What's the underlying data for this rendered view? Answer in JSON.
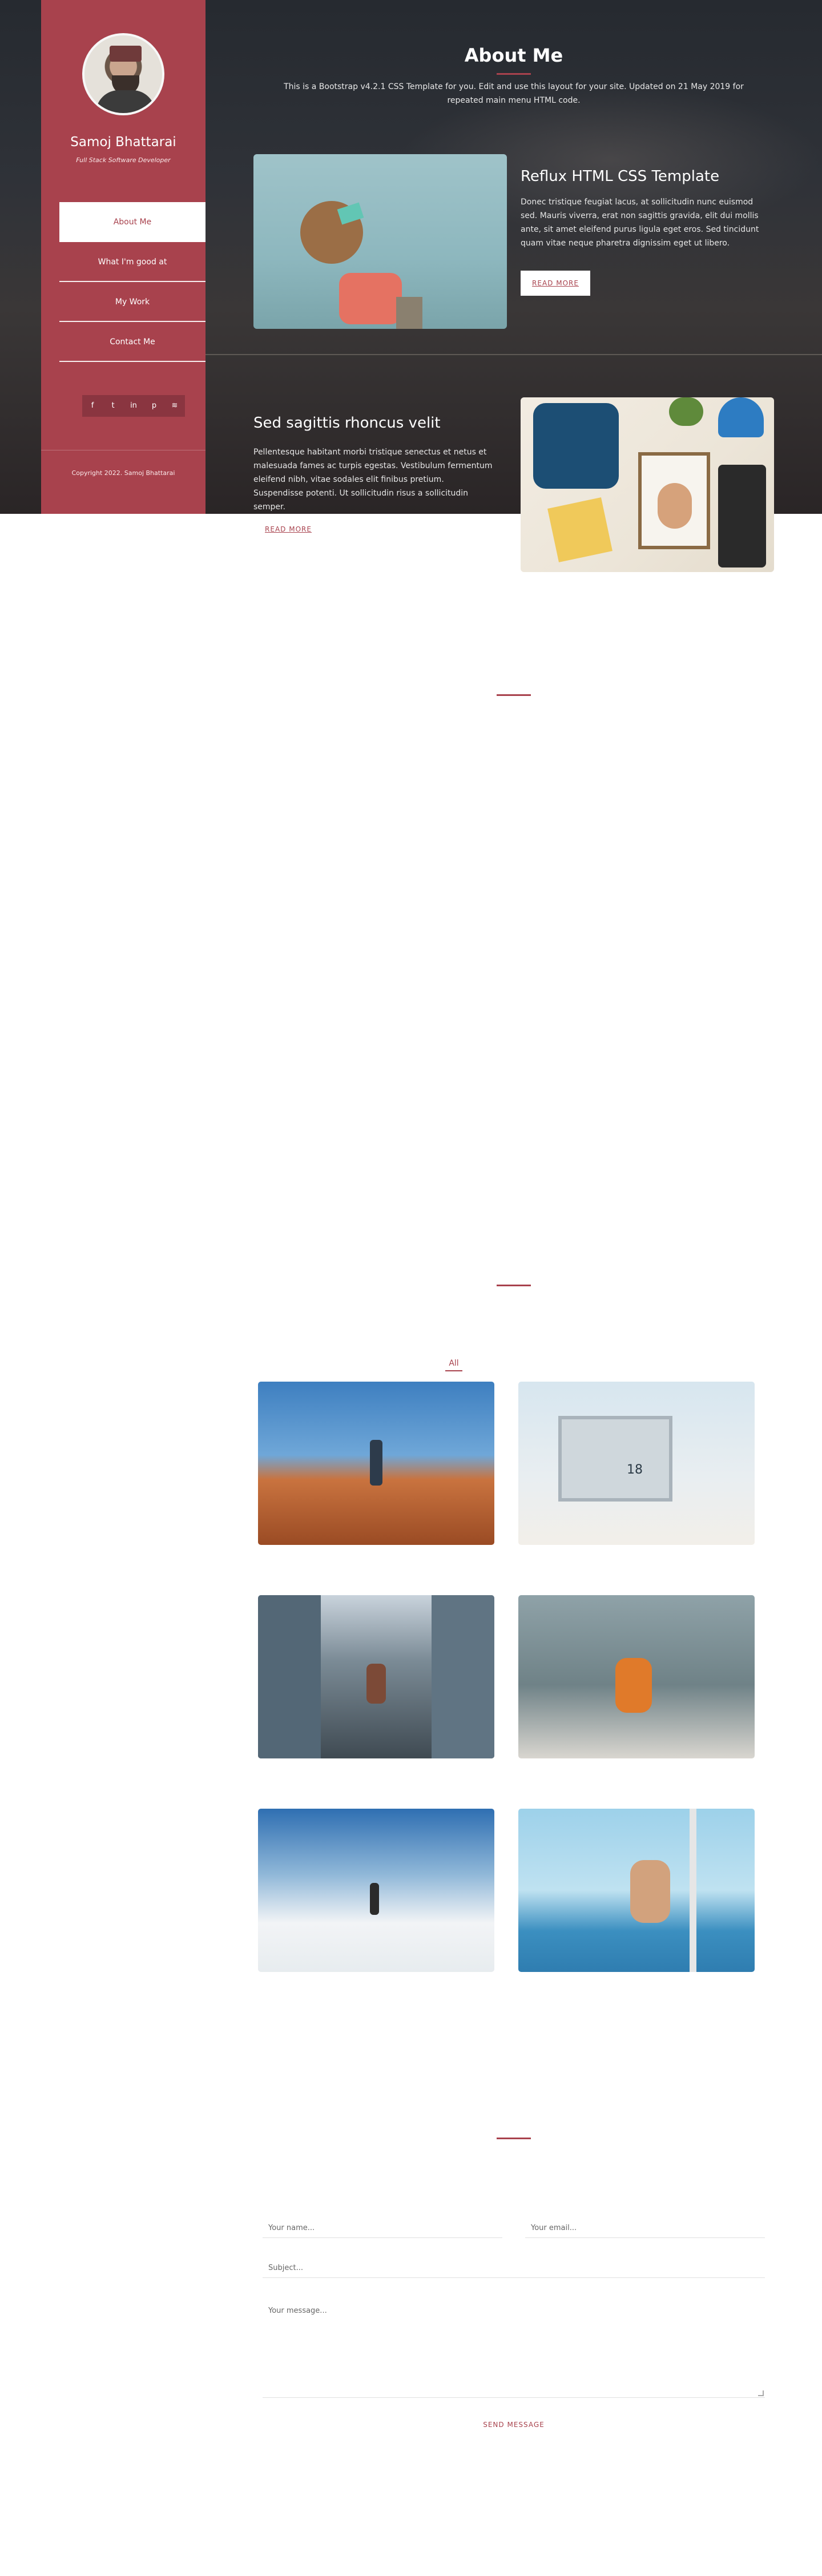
{
  "sidebar": {
    "name": "Samoj Bhattarai",
    "title": "Full Stack Software Developer",
    "nav": [
      {
        "label": "About Me"
      },
      {
        "label": "What I'm good at"
      },
      {
        "label": "My Work"
      },
      {
        "label": "Contact Me"
      }
    ],
    "social_icons": [
      "facebook-icon",
      "twitter-icon",
      "linkedin-icon",
      "pinterest-icon",
      "rss-icon"
    ],
    "copyright": "Copyright 2022. Samoj Bhattarai"
  },
  "hero": {
    "title": "About Me",
    "subtitle": "This is a Bootstrap v4.2.1 CSS Template for you. Edit and use this layout for your site. Updated on 21 May 2019 for repeated main menu HTML code."
  },
  "features": [
    {
      "title": "Reflux HTML CSS Template",
      "body": "Donec tristique feugiat lacus, at sollicitudin nunc euismod sed. Mauris viverra, erat non sagittis gravida, elit dui mollis ante, sit amet eleifend purus ligula eget eros. Sed tincidunt quam vitae neque pharetra dignissim eget ut libero.",
      "button": "READ MORE"
    },
    {
      "title": "Sed sagittis rhoncus velit",
      "body": "Pellentesque habitant morbi tristique senectus et netus et malesuada fames ac turpis egestas. Vestibulum fermentum eleifend nibh, vitae sodales elit finibus pretium. Suspendisse potenti. Ut sollicitudin risus a sollicitudin semper.",
      "button": "READ MORE"
    }
  ],
  "gallery": {
    "filter_label": "All",
    "items": [
      {
        "id": "photo-canyon"
      },
      {
        "id": "photo-lifeguard-tower",
        "tower_number": "18"
      },
      {
        "id": "photo-city-reflection"
      },
      {
        "id": "photo-jumping-man"
      },
      {
        "id": "photo-snow-peak"
      },
      {
        "id": "photo-sailboat-jump"
      }
    ]
  },
  "contact": {
    "name_placeholder": "Your name...",
    "email_placeholder": "Your email...",
    "subject_placeholder": "Subject...",
    "message_placeholder": "Your message...",
    "send_button": "SEND MESSAGE"
  },
  "colors": {
    "accent": "#a8424d",
    "hero_dark": "#2f3238"
  }
}
